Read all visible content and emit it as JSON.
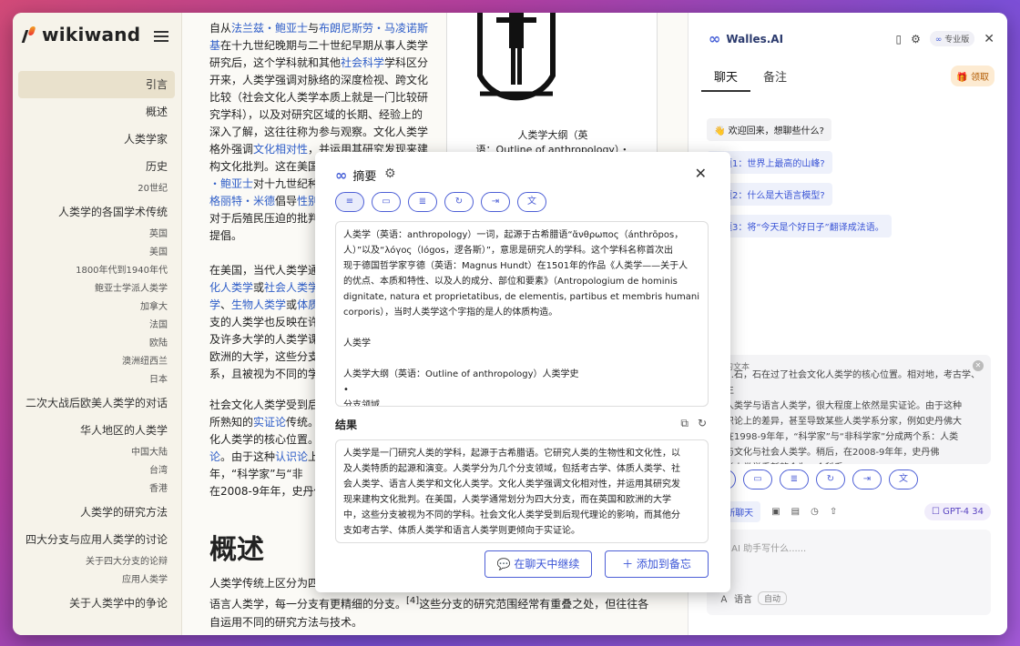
{
  "app": {
    "logo_text": "wikiwand"
  },
  "toc": [
    {
      "label": "引言",
      "level": 1,
      "active": true
    },
    {
      "label": "概述",
      "level": 1
    },
    {
      "label": "人类学家",
      "level": 1
    },
    {
      "label": "历史",
      "level": 1
    },
    {
      "label": "20世纪",
      "level": 2
    },
    {
      "label": "人类学的各国学术传统",
      "level": 1
    },
    {
      "label": "英国",
      "level": 2
    },
    {
      "label": "美国",
      "level": 2
    },
    {
      "label": "1800年代到1940年代",
      "level": 2
    },
    {
      "label": "鲍亚士学派人类学",
      "level": 2
    },
    {
      "label": "加拿大",
      "level": 2
    },
    {
      "label": "法国",
      "level": 2
    },
    {
      "label": "欧陆",
      "level": 2
    },
    {
      "label": "澳洲纽西兰",
      "level": 2
    },
    {
      "label": "日本",
      "level": 2
    },
    {
      "label": "二次大战后欧美人类学的对话",
      "level": 1
    },
    {
      "label": "华人地区的人类学",
      "level": 1
    },
    {
      "label": "中国大陆",
      "level": 2
    },
    {
      "label": "台湾",
      "level": 2
    },
    {
      "label": "香港",
      "level": 2
    },
    {
      "label": "人类学的研究方法",
      "level": 1
    },
    {
      "label": "四大分支与应用人类学的讨论",
      "level": 1
    },
    {
      "label": "关于四大分支的论辩",
      "level": 2
    },
    {
      "label": "应用人类学",
      "level": 2
    },
    {
      "label": "关于人类学中的争论",
      "level": 1
    }
  ],
  "article": {
    "para1_html_lines": [
      "自从<span class='lk'>法兰兹・鲍亚士</span>与<span class='lk'>布朗尼斯劳・马凌诺斯</span>",
      "<span class='lk'>基</span>在十九世纪晚期与二十世纪早期从事人类学",
      "研究后，这个学科就和其他<span class='lk'>社会科学</span>学科区分",
      "开来，人类学强调对脉络的深度检视、跨文化",
      "比较（社会文化人类学本质上就是一门比较研",
      "究学科），以及对研究区域的长期、经验上的",
      "深入了解，这往往称为参与观察。文化人类学",
      "格外强调<span class='lk'>文化相对性</span>，并运用其研究发现来建",
      "构文化批判。这在美国",
      "<span class='lk'>・鲍亚士</span>对十九世纪种",
      "<span class='lk'>格丽特・米德</span>倡导<span class='lk'>性别</span>",
      "对于后殖民压迫的批判",
      "提倡。"
    ],
    "para2_html_lines": [
      "在美国，当代人类学通",
      "<span class='lk'>化人类学</span>或<span class='lk'>社会人类学</span>",
      "<span class='lk'>学</span>、<span class='lk'>生物人类学</span>或<span class='lk'>体质</span>",
      "支的人类学也反映在许",
      "及许多大学的人类学课",
      "欧洲的大学，这些分支",
      "系，且被视为不同的学"
    ],
    "para3_html_lines": [
      "社会文化人类学受到后",
      "所熟知的<span class='lk'>实证论</span>传统。",
      "化人类学的核心位置。",
      "<span class='lk'>论</span>。由于这种<span class='lk'>认识论</span>上",
      "年，“科学家”与“非",
      "在2008-9年年，史丹佛"
    ],
    "figure_caption_lines": [
      "人类学大纲（英",
      "语：Outline of anthropology）・"
    ],
    "heading": "概述",
    "overview_html_lines": [
      "人类学传统上区分为四",
      "<span class='lk'>语言人类学</span>，每一分支有更精细的分支。<sup>[4]</sup>这些分支的研究范围经常有重叠之处，但往往各",
      "自运用不同的研究方法与技术。"
    ]
  },
  "sidebar": {
    "brand": "Walles.AI",
    "plan_badge": "专业版",
    "tabs": [
      "聊天",
      "备注"
    ],
    "claim_label": "领取",
    "welcome": "欢迎回来，想聊些什么?",
    "questions": [
      "问题1：世界上最高的山峰?",
      "问题2：什么是大语言模型?",
      "问题3：将“今天是个好日子”翻译成法语。"
    ],
    "quote_header": "的文本",
    "quote_lines": [
      "…石，石在过了社会文化人类学的核心位置。相对地，考古学、生",
      "人类学与语言人类学，很大程度上依然是实证论。由于这种",
      "识论上的差异，甚至导致某些人类学系分家，例如史丹佛大",
      "在1998-9年年，“科学家”与“非科学家”分成两个系：人类",
      "与文化与社会人类学。稍后，在2008-9年年，史丹佛",
      "学人类学重新整合为一个科系。"
    ],
    "new_chat_label": "新聊天",
    "model_label": "GPT-4",
    "model_count": "34",
    "input_placeholder": "示 AI 助手写什么......",
    "language_label": "语言",
    "language_value": "自动"
  },
  "summary_popup": {
    "title": "摘要",
    "source_lines": [
      "人类学（英语：anthropology）一词，起源于古希腊语“ἄνθρωπος（ánthrōpos，",
      "人）”以及“λόγος（lógos，逻各斯）”，意思是研究人的学科。这个学科名称首次出",
      "现于德国哲学家亨德（英语：Magnus Hundt）在1501年的作品《人类学——关于人",
      "的优点、本质和特性、以及人的成分、部位和要素》（Antropologium de hominis",
      "dignitate, natura et proprietatibus, de elementis, partibus et membris humani",
      "corporis），当时人类学这个字指的是人的体质构造。",
      "",
      "人类学",
      "",
      "人类学大纲（英语：Outline of anthropology）人类学史",
      "•",
      "分支领域"
    ],
    "result_label": "结果",
    "result_lines": [
      "人类学是一门研究人类的学科，起源于古希腊语。它研究人类的生物性和文化性，以",
      "及人类特质的起源和演变。人类学分为几个分支领域，包括考古学、体质人类学、社",
      "会人类学、语言人类学和文化人类学。文化人类学强调文化相对性，并运用其研究发",
      "现来建构文化批判。在美国，人类学通常划分为四大分支，而在英国和欧洲的大学",
      "中，这些分支被视为不同的学科。社会文化人类学受到后现代理论的影响，而其他分",
      "支如考古学、体质人类学和语言人类学则更倾向于实证论。"
    ],
    "continue_label": "在聊天中继续",
    "add_note_label": "添加到备忘"
  }
}
